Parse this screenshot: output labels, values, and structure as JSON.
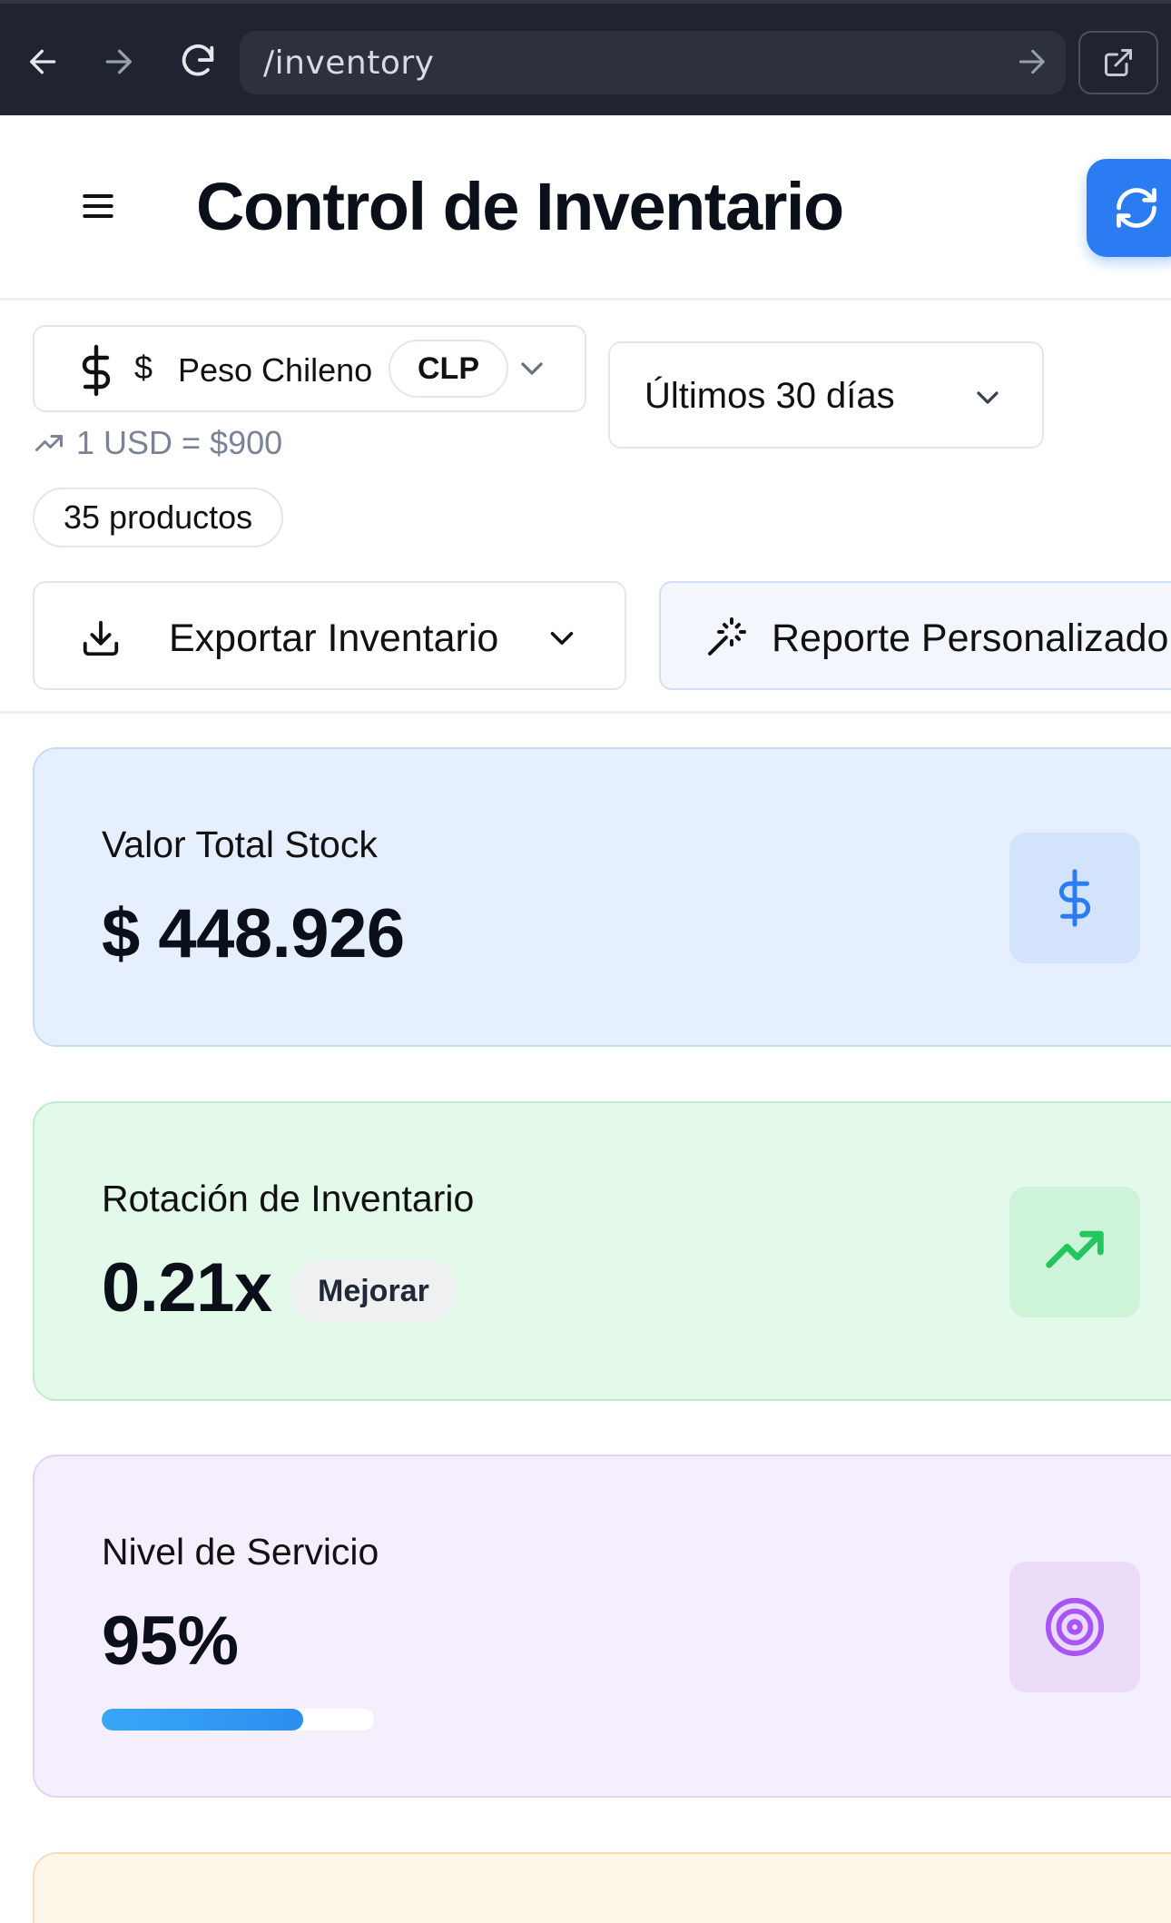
{
  "browser": {
    "url": "/inventory"
  },
  "header": {
    "title": "Control de Inventario"
  },
  "controls": {
    "currency": {
      "symbol": "$",
      "name": "Peso Chileno",
      "code": "CLP"
    },
    "exchange_rate": "1 USD = $900",
    "product_count": "35 productos",
    "period": "Últimos 30 días",
    "export_label": "Exportar Inventario",
    "report_label": "Reporte Personalizado"
  },
  "cards": [
    {
      "label": "Valor Total Stock",
      "value": "$ 448.926",
      "icon": "dollar-icon",
      "accent": "#2b7cf2"
    },
    {
      "label": "Rotación de Inventario",
      "value": "0.21x",
      "badge": "Mejorar",
      "icon": "trending-up-icon",
      "accent": "#22c55e"
    },
    {
      "label": "Nivel de Servicio",
      "value": "95%",
      "progress": 0.74,
      "icon": "target-icon",
      "accent": "#a855f7"
    }
  ],
  "colors": {
    "browser_bar": "#1f2430",
    "primary": "#2b7cf2",
    "card_blue_bg": "#e6effd",
    "card_green_bg": "#e3f9e9",
    "card_purple_bg": "#f5effd",
    "card_orange_bg": "#fff6ea"
  }
}
